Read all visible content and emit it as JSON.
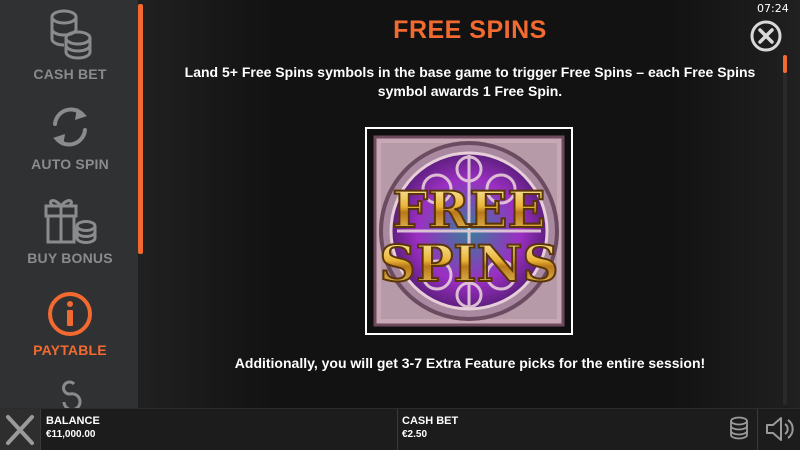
{
  "sidebar": {
    "items": [
      {
        "label": "CASH BET",
        "icon": "coins-icon"
      },
      {
        "label": "AUTO SPIN",
        "icon": "refresh-icon"
      },
      {
        "label": "BUY BONUS",
        "icon": "gift-icon"
      },
      {
        "label": "PAYTABLE",
        "icon": "info-icon",
        "active": true
      },
      {
        "label": "",
        "icon": "settings-partial-icon"
      }
    ]
  },
  "status": {
    "time": "07:24"
  },
  "paytable": {
    "title": "FREE SPINS",
    "description": "Land 5+ Free Spins symbols in the base game to trigger Free Spins – each Free Spins symbol awards 1 Free Spin.",
    "symbol_text_line1": "FREE",
    "symbol_text_line2": "SPINS",
    "extra_text": "Additionally, you will get 3-7 Extra Feature picks for the entire session!"
  },
  "bottom_bar": {
    "balance_label": "BALANCE",
    "balance_value": "€11,000.00",
    "cash_bet_label": "CASH BET",
    "cash_bet_value": "€2.50"
  },
  "colors": {
    "accent": "#f26a30",
    "sidebar_bg": "#303133",
    "inactive_text": "#8a8b8d"
  }
}
